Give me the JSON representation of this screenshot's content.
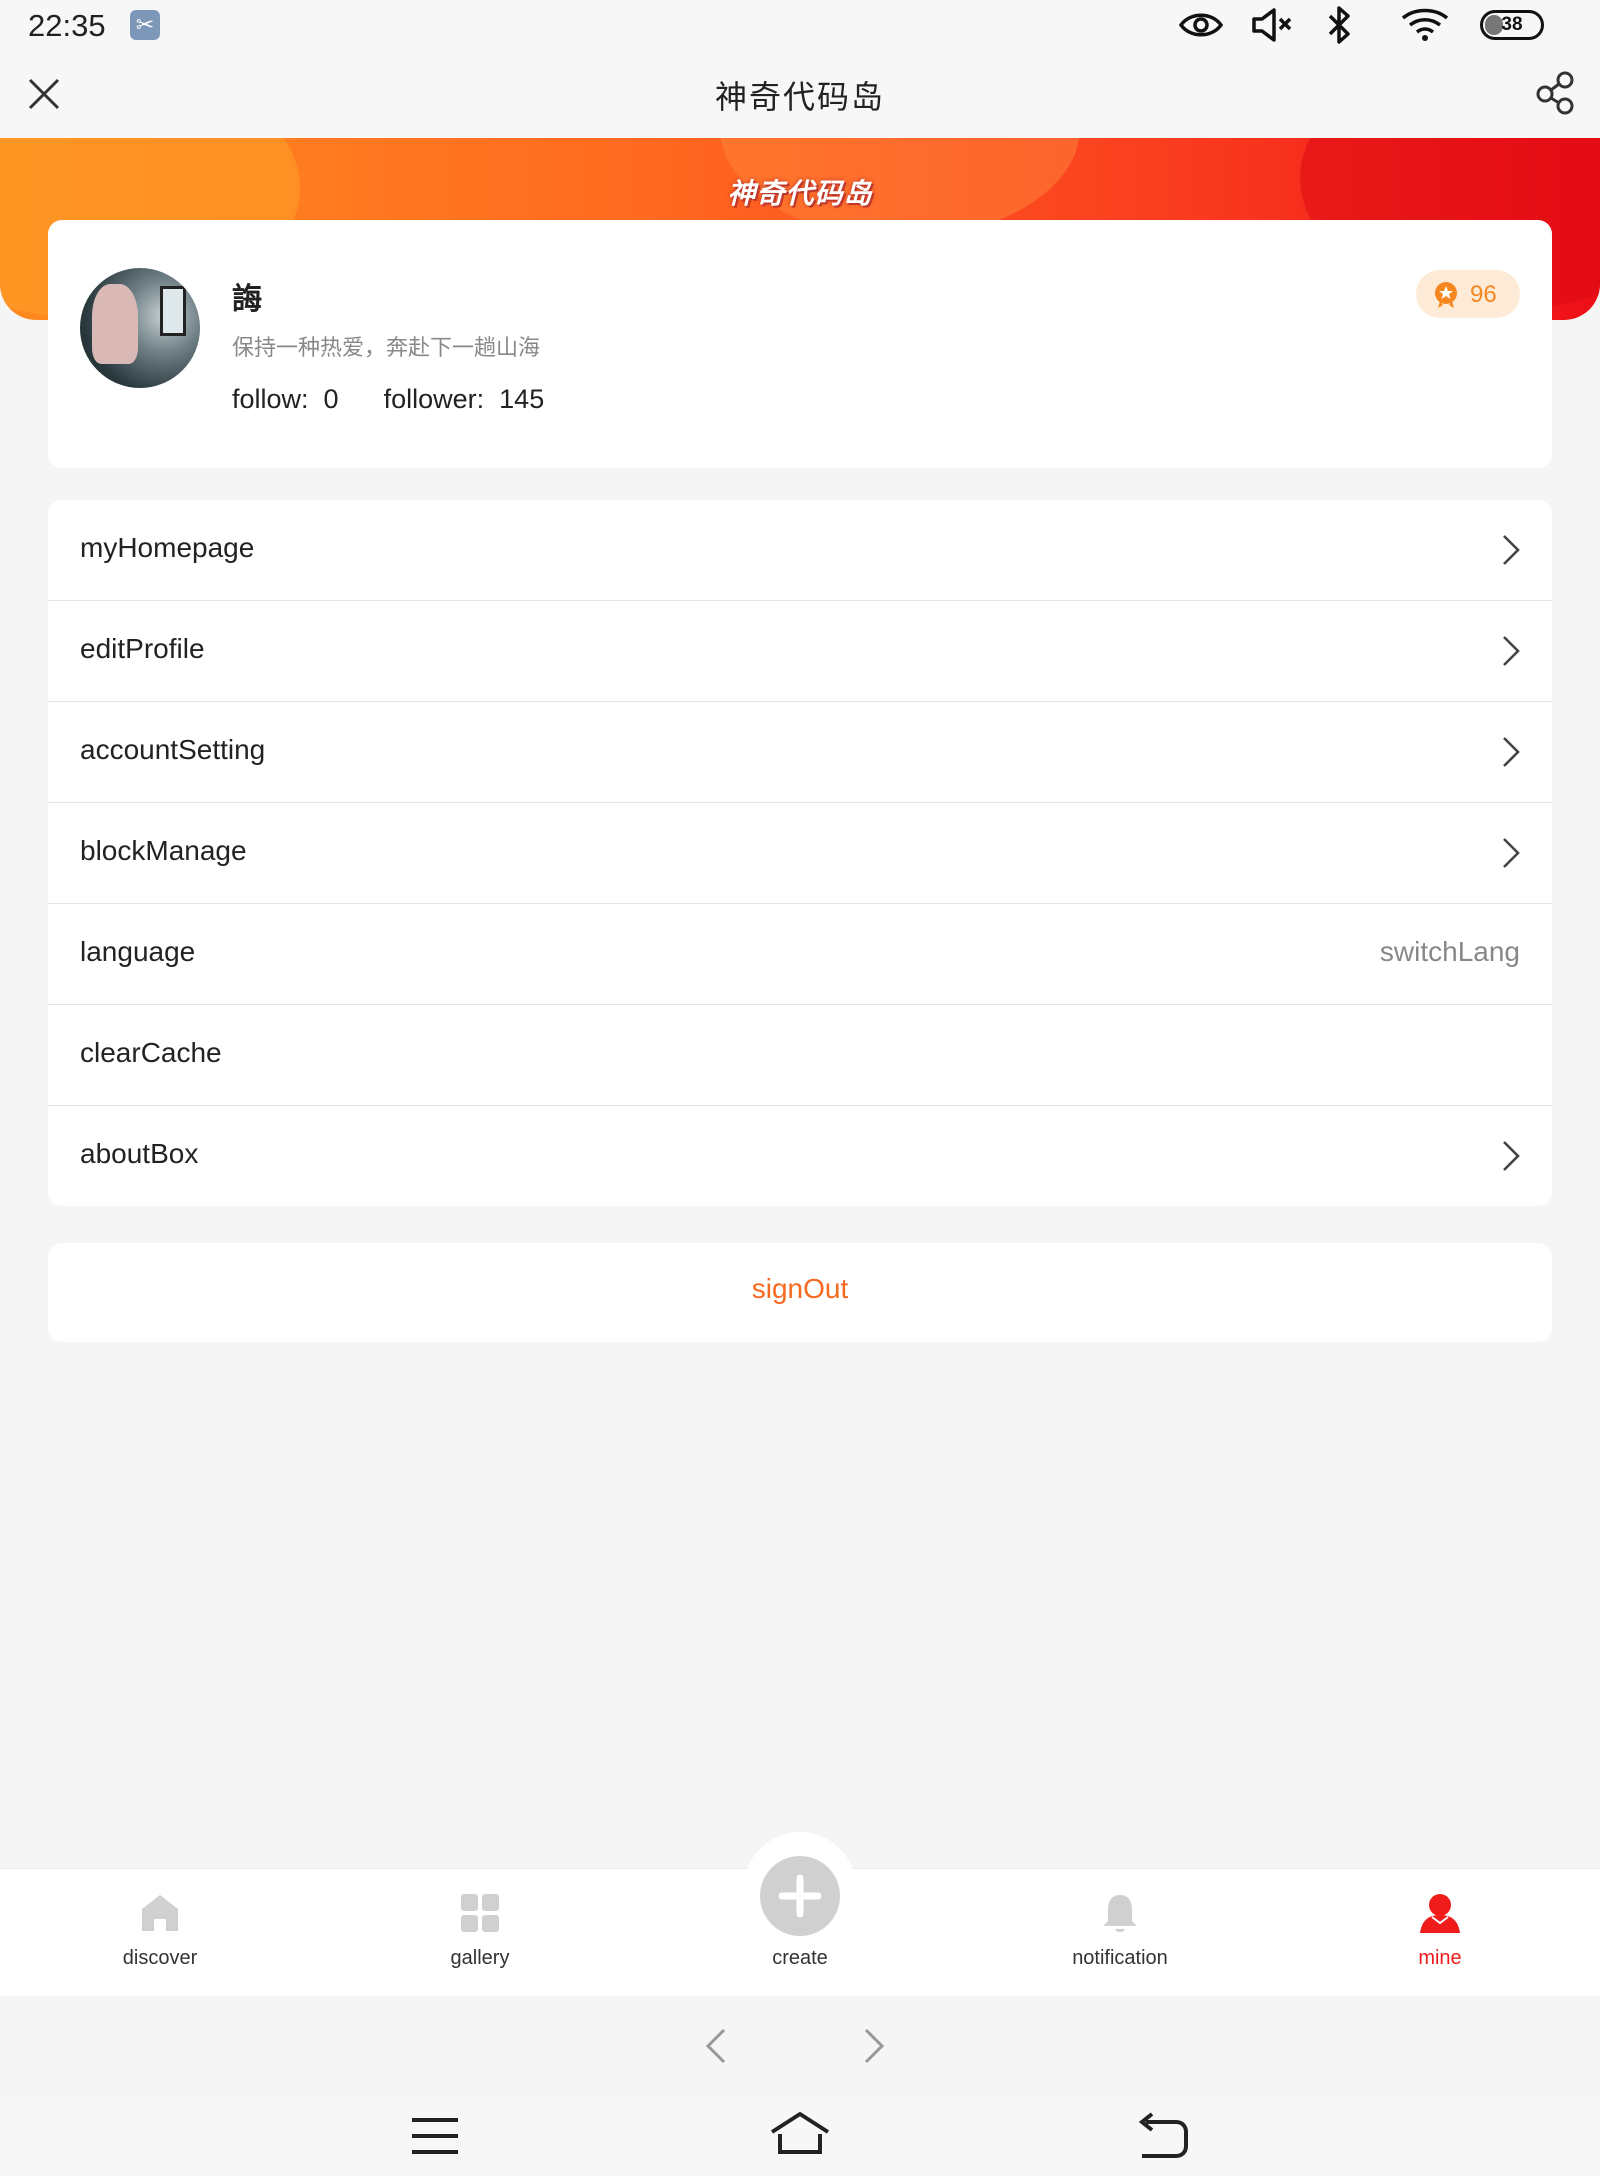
{
  "status_bar": {
    "time": "22:35",
    "battery": "38",
    "icons": [
      "scissors-app-icon",
      "eye-icon",
      "mute-icon",
      "bluetooth-icon",
      "wifi-icon",
      "battery-icon"
    ]
  },
  "header": {
    "title": "神奇代码岛",
    "left_icon": "close-icon",
    "right_icon": "share-icon"
  },
  "banner": {
    "logo_text": "神奇代码岛",
    "colors": {
      "start": "#ff8a1f",
      "end": "#ee0f17"
    }
  },
  "profile": {
    "username": "誨",
    "signature": "保持一种热爱，奔赴下一趟山海",
    "follow_label": "follow:",
    "follow_count": "0",
    "follower_label": "follower:",
    "follower_count": "145",
    "points": "96"
  },
  "menu": {
    "items": [
      {
        "label": "myHomepage",
        "value": "",
        "chevron": true
      },
      {
        "label": "editProfile",
        "value": "",
        "chevron": true
      },
      {
        "label": "accountSetting",
        "value": "",
        "chevron": true
      },
      {
        "label": "blockManage",
        "value": "",
        "chevron": true
      },
      {
        "label": "language",
        "value": "switchLang",
        "chevron": false
      },
      {
        "label": "clearCache",
        "value": "",
        "chevron": false
      },
      {
        "label": "aboutBox",
        "value": "",
        "chevron": true
      }
    ]
  },
  "signout": {
    "label": "signOut",
    "color": "#f56a1f"
  },
  "tabbar": {
    "tabs": [
      {
        "label": "discover",
        "icon": "home-icon"
      },
      {
        "label": "gallery",
        "icon": "grid-icon"
      },
      {
        "label": "create",
        "icon": "plus-icon"
      },
      {
        "label": "notification",
        "icon": "bell-icon"
      },
      {
        "label": "mine",
        "icon": "person-icon"
      }
    ],
    "active": "mine",
    "active_color": "#f01b1b"
  },
  "browser_nav": {
    "icons": [
      "back-arrow-icon",
      "forward-arrow-icon"
    ]
  },
  "system_nav": {
    "icons": [
      "menu-icon",
      "home-outline-icon",
      "return-icon"
    ]
  }
}
